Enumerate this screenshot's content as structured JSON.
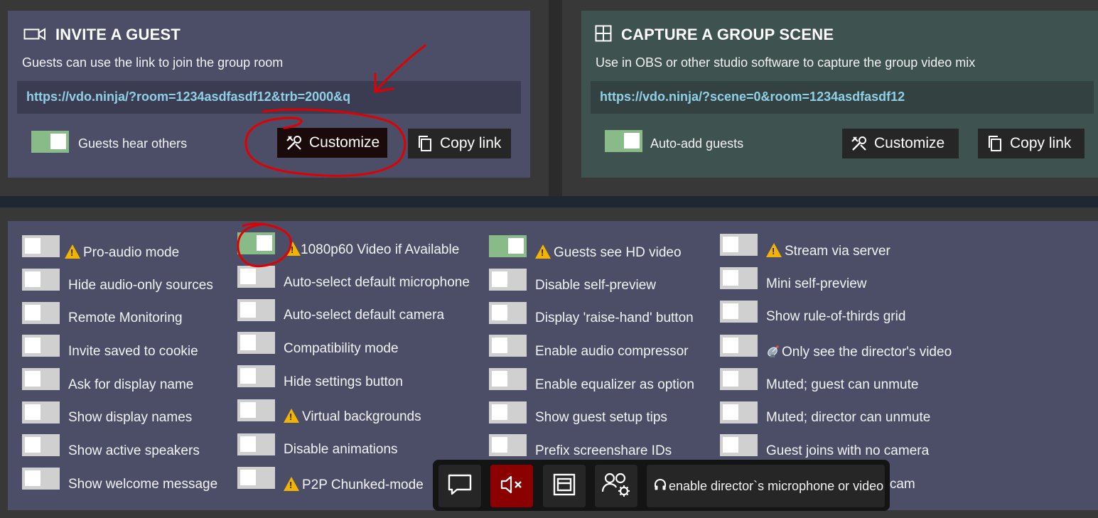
{
  "invite": {
    "title": "INVITE A GUEST",
    "description": "Guests can use the link to join the group room",
    "link": "https://vdo.ninja/?room=1234asdfasdf12&trb=2000&q",
    "toggle_label": "Guests hear others",
    "toggle_on": true,
    "customize_label": "Customize",
    "copy_label": "Copy link"
  },
  "scene": {
    "title": "CAPTURE A GROUP SCENE",
    "description": "Use in OBS or other studio software to capture the group video mix",
    "link": "https://vdo.ninja/?scene=0&room=1234asdfasdf12",
    "toggle_label": "Auto-add guests",
    "toggle_on": true,
    "customize_label": "Customize",
    "copy_label": "Copy link"
  },
  "options": {
    "col1": [
      {
        "label": "Pro-audio mode",
        "on": false,
        "warn": true
      },
      {
        "label": "Hide audio-only sources",
        "on": false,
        "warn": false
      },
      {
        "label": "Remote Monitoring",
        "on": false,
        "warn": false
      },
      {
        "label": "Invite saved to cookie",
        "on": false,
        "warn": false
      },
      {
        "label": "Ask for display name",
        "on": false,
        "warn": false
      },
      {
        "label": "Show display names",
        "on": false,
        "warn": false
      },
      {
        "label": "Show active speakers",
        "on": false,
        "warn": false
      },
      {
        "label": "Show welcome message",
        "on": false,
        "warn": false
      }
    ],
    "col2": [
      {
        "label": "1080p60 Video if Available",
        "on": true,
        "warn": true
      },
      {
        "label": "Auto-select default microphone",
        "on": false,
        "warn": false
      },
      {
        "label": "Auto-select default camera",
        "on": false,
        "warn": false
      },
      {
        "label": "Compatibility mode",
        "on": false,
        "warn": false
      },
      {
        "label": "Hide settings button",
        "on": false,
        "warn": false
      },
      {
        "label": "Virtual backgrounds",
        "on": false,
        "warn": true
      },
      {
        "label": "Disable animations",
        "on": false,
        "warn": false
      },
      {
        "label": "P2P Chunked-mode",
        "on": false,
        "warn": true
      }
    ],
    "col3": [
      {
        "label": "Guests see HD video",
        "on": true,
        "warn": true
      },
      {
        "label": "Disable self-preview",
        "on": false,
        "warn": false
      },
      {
        "label": "Display 'raise-hand' button",
        "on": false,
        "warn": false
      },
      {
        "label": "Enable audio compressor",
        "on": false,
        "warn": false
      },
      {
        "label": "Enable equalizer as option",
        "on": false,
        "warn": false
      },
      {
        "label": "Show guest setup tips",
        "on": false,
        "warn": false
      },
      {
        "label": "Prefix screenshare IDs",
        "on": false,
        "warn": false
      }
    ],
    "col4": [
      {
        "label": "Stream via server",
        "on": false,
        "warn": true
      },
      {
        "label": "Mini self-preview",
        "on": false,
        "warn": false
      },
      {
        "label": "Show rule-of-thirds grid",
        "on": false,
        "warn": false
      },
      {
        "label": "Only see the director's video",
        "on": false,
        "warn": false,
        "satellite": true
      },
      {
        "label": "Muted; guest can unmute",
        "on": false,
        "warn": false
      },
      {
        "label": "Muted; director can unmute",
        "on": false,
        "warn": false
      },
      {
        "label": "Guest joins with no camera",
        "on": false,
        "warn": false
      }
    ],
    "partial_label": "e.cam"
  },
  "toolbar": {
    "enable_label": "enable director`s microphone or video",
    "icons": [
      "chat-icon",
      "speaker-muted-icon",
      "layout-icon",
      "group-settings-icon",
      "headphones-icon"
    ]
  },
  "colors": {
    "invite_card": "#4c4e68",
    "scene_card": "#3e5250",
    "link_text": "#8fd0e8",
    "toggle_on": "#88bb88",
    "toggle_off": "#d0d0d0",
    "mute_button": "#8b0000",
    "annotation": "#e00000"
  }
}
